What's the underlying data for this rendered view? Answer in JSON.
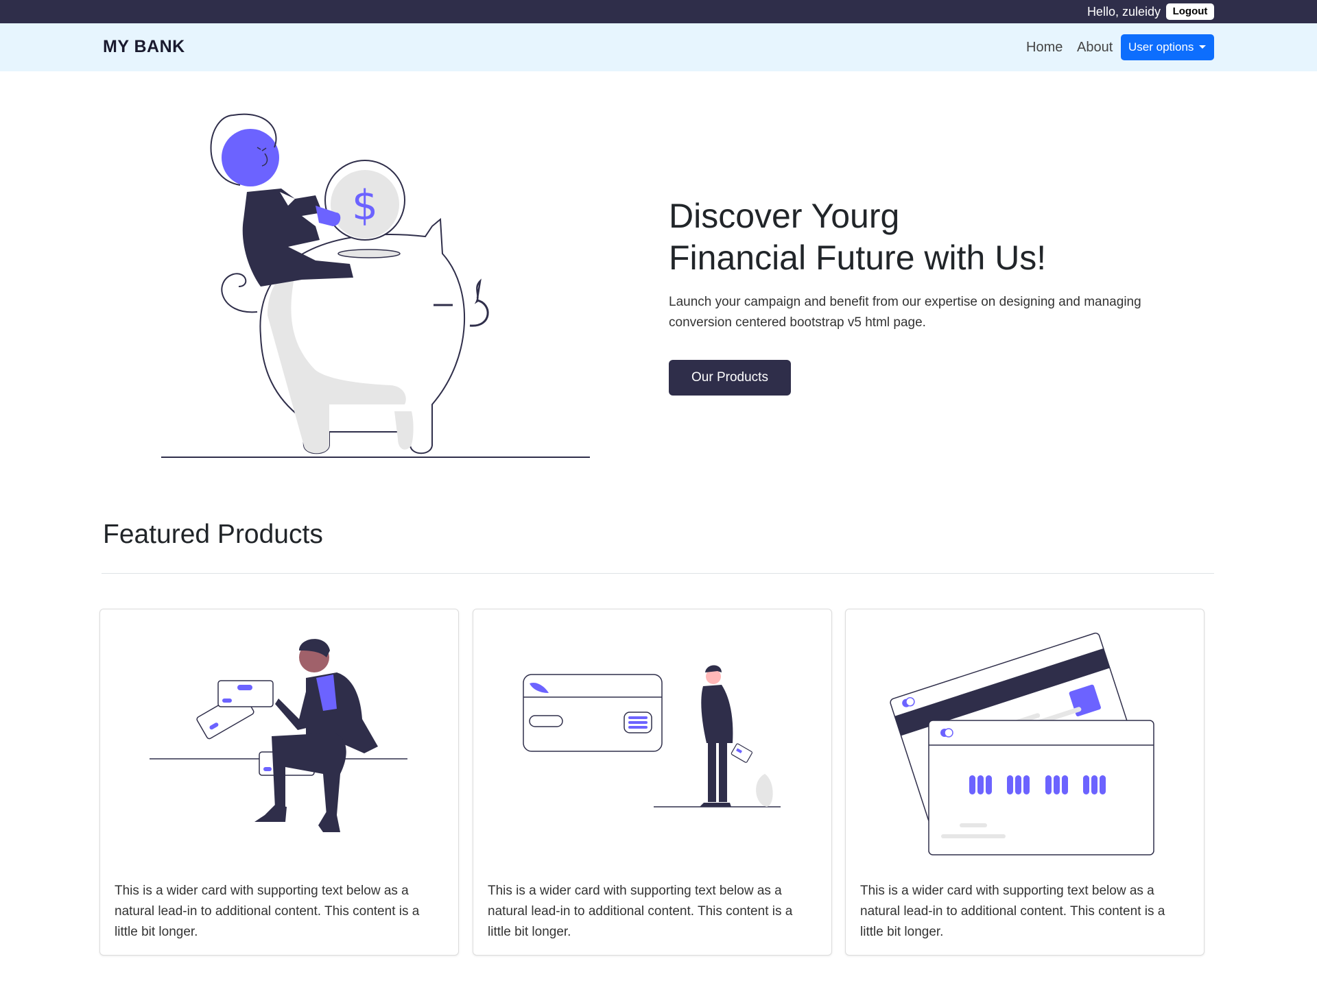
{
  "topbar": {
    "greeting": "Hello, zuleidy",
    "logout_label": "Logout"
  },
  "navbar": {
    "brand": "MY BANK",
    "links": [
      "Home",
      "About"
    ],
    "user_options_label": "User options"
  },
  "hero": {
    "title_line1": "Discover Yourg",
    "title_line2": "Financial Future with Us!",
    "text": "Launch your campaign and benefit from our expertise on designing and managing conversion centered bootstrap v5 html page.",
    "button_label": "Our Products"
  },
  "featured": {
    "title": "Featured Products",
    "cards": [
      {
        "text": "This is a wider card with supporting text below as a natural lead-in to additional content. This content is a little bit longer."
      },
      {
        "text": "This is a wider card with supporting text below as a natural lead-in to additional content. This content is a little bit longer."
      },
      {
        "text": "This is a wider card with supporting text below as a natural lead-in to additional content. This content is a little bit longer."
      }
    ]
  },
  "colors": {
    "dark": "#2f2e4a",
    "accent": "#6c63ff",
    "primary": "#0d6efd",
    "navbar_bg": "#e7f5fe"
  }
}
